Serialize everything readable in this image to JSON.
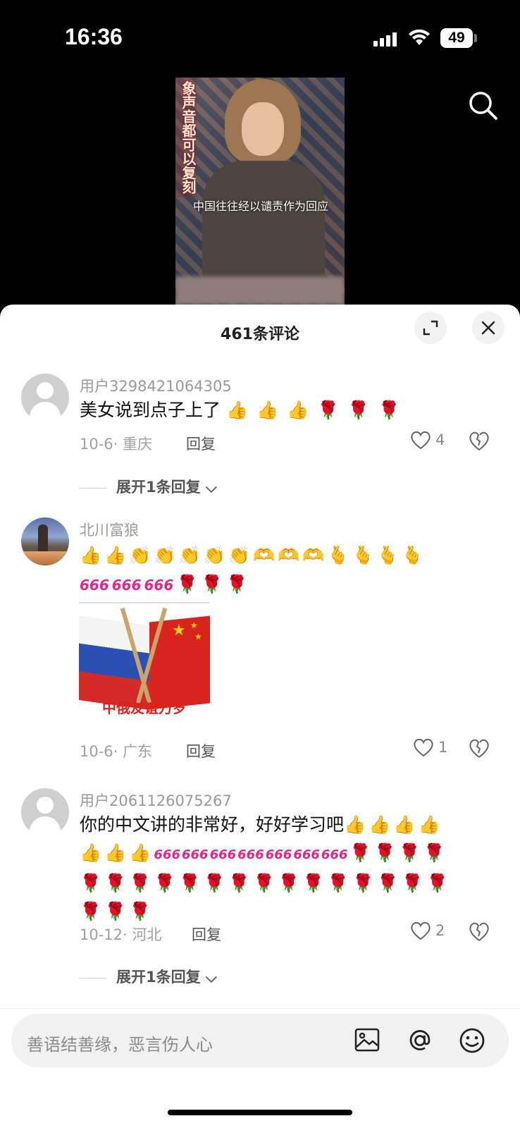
{
  "status_bar": {
    "time": "16:36",
    "battery": "49"
  },
  "video": {
    "overlay_vertical_text": "象声音都可以复刻",
    "caption": "中国往往经以谴责作为回应"
  },
  "comments_panel": {
    "title": "461条评论",
    "comments": [
      {
        "username": "用户3298421064305",
        "text": "美女说到点子上了",
        "emojis": [
          "👍",
          "👍",
          "👍",
          "🌹",
          "🌹",
          "🌹"
        ],
        "date_location": "10-6· 重庆",
        "reply_label": "回复",
        "likes": "4",
        "expand_replies": "展开1条回复"
      },
      {
        "username": "北川富狼",
        "emojis_line1": [
          "👍",
          "👍",
          "👏",
          "👏",
          "👏",
          "👏",
          "👏",
          "🫶",
          "🫶",
          "🫶",
          "🫰",
          "🫰",
          "🫰",
          "🫰"
        ],
        "emojis_line2": [
          "666",
          "666",
          "666",
          "🌹",
          "🌹",
          "🌹"
        ],
        "image_caption": "中俄友谊万岁",
        "date_location": "10-6· 广东",
        "reply_label": "回复",
        "likes": "1"
      },
      {
        "username": "用户2061126075267",
        "text": "你的中文讲的非常好，好好学习吧",
        "emojis_line1": [
          "👍",
          "👍",
          "👍",
          "👍"
        ],
        "emojis_line2": [
          "👍",
          "👍",
          "👍",
          "666",
          "666",
          "666",
          "666",
          "666",
          "666",
          "666",
          "🌹",
          "🌹",
          "🌹",
          "🌹"
        ],
        "emojis_line3": [
          "🌹",
          "🌹",
          "🌹",
          "🌹",
          "🌹",
          "🌹",
          "🌹",
          "🌹",
          "🌹",
          "🌹",
          "🌹",
          "🌹",
          "🌹",
          "🌹",
          "🌹"
        ],
        "emojis_line4": [
          "🌹",
          "🌹",
          "🌹"
        ],
        "date_location": "10-12· 河北",
        "reply_label": "回复",
        "likes": "2",
        "expand_replies": "展开1条回复"
      }
    ]
  },
  "input": {
    "placeholder": "善语结善缘，恶言伤人心"
  }
}
